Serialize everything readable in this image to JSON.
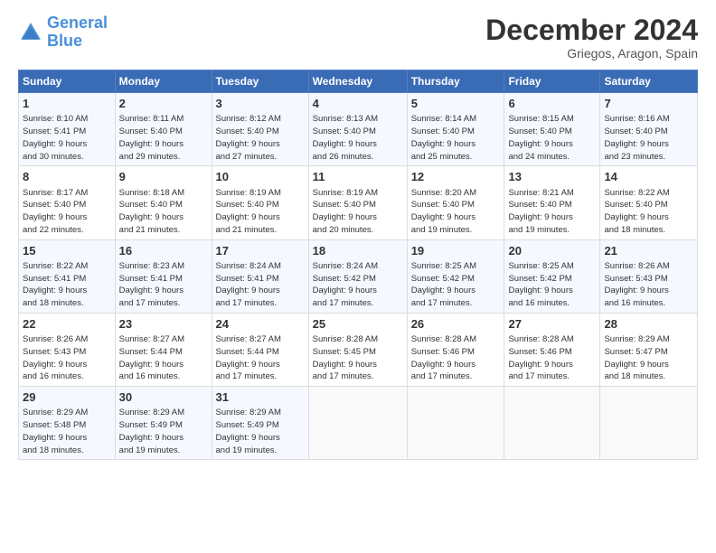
{
  "header": {
    "logo_line1": "General",
    "logo_line2": "Blue",
    "month_title": "December 2024",
    "subtitle": "Griegos, Aragon, Spain"
  },
  "weekdays": [
    "Sunday",
    "Monday",
    "Tuesday",
    "Wednesday",
    "Thursday",
    "Friday",
    "Saturday"
  ],
  "weeks": [
    [
      {
        "day": "1",
        "info": "Sunrise: 8:10 AM\nSunset: 5:41 PM\nDaylight: 9 hours\nand 30 minutes."
      },
      {
        "day": "2",
        "info": "Sunrise: 8:11 AM\nSunset: 5:40 PM\nDaylight: 9 hours\nand 29 minutes."
      },
      {
        "day": "3",
        "info": "Sunrise: 8:12 AM\nSunset: 5:40 PM\nDaylight: 9 hours\nand 27 minutes."
      },
      {
        "day": "4",
        "info": "Sunrise: 8:13 AM\nSunset: 5:40 PM\nDaylight: 9 hours\nand 26 minutes."
      },
      {
        "day": "5",
        "info": "Sunrise: 8:14 AM\nSunset: 5:40 PM\nDaylight: 9 hours\nand 25 minutes."
      },
      {
        "day": "6",
        "info": "Sunrise: 8:15 AM\nSunset: 5:40 PM\nDaylight: 9 hours\nand 24 minutes."
      },
      {
        "day": "7",
        "info": "Sunrise: 8:16 AM\nSunset: 5:40 PM\nDaylight: 9 hours\nand 23 minutes."
      }
    ],
    [
      {
        "day": "8",
        "info": "Sunrise: 8:17 AM\nSunset: 5:40 PM\nDaylight: 9 hours\nand 22 minutes."
      },
      {
        "day": "9",
        "info": "Sunrise: 8:18 AM\nSunset: 5:40 PM\nDaylight: 9 hours\nand 21 minutes."
      },
      {
        "day": "10",
        "info": "Sunrise: 8:19 AM\nSunset: 5:40 PM\nDaylight: 9 hours\nand 21 minutes."
      },
      {
        "day": "11",
        "info": "Sunrise: 8:19 AM\nSunset: 5:40 PM\nDaylight: 9 hours\nand 20 minutes."
      },
      {
        "day": "12",
        "info": "Sunrise: 8:20 AM\nSunset: 5:40 PM\nDaylight: 9 hours\nand 19 minutes."
      },
      {
        "day": "13",
        "info": "Sunrise: 8:21 AM\nSunset: 5:40 PM\nDaylight: 9 hours\nand 19 minutes."
      },
      {
        "day": "14",
        "info": "Sunrise: 8:22 AM\nSunset: 5:40 PM\nDaylight: 9 hours\nand 18 minutes."
      }
    ],
    [
      {
        "day": "15",
        "info": "Sunrise: 8:22 AM\nSunset: 5:41 PM\nDaylight: 9 hours\nand 18 minutes."
      },
      {
        "day": "16",
        "info": "Sunrise: 8:23 AM\nSunset: 5:41 PM\nDaylight: 9 hours\nand 17 minutes."
      },
      {
        "day": "17",
        "info": "Sunrise: 8:24 AM\nSunset: 5:41 PM\nDaylight: 9 hours\nand 17 minutes."
      },
      {
        "day": "18",
        "info": "Sunrise: 8:24 AM\nSunset: 5:42 PM\nDaylight: 9 hours\nand 17 minutes."
      },
      {
        "day": "19",
        "info": "Sunrise: 8:25 AM\nSunset: 5:42 PM\nDaylight: 9 hours\nand 17 minutes."
      },
      {
        "day": "20",
        "info": "Sunrise: 8:25 AM\nSunset: 5:42 PM\nDaylight: 9 hours\nand 16 minutes."
      },
      {
        "day": "21",
        "info": "Sunrise: 8:26 AM\nSunset: 5:43 PM\nDaylight: 9 hours\nand 16 minutes."
      }
    ],
    [
      {
        "day": "22",
        "info": "Sunrise: 8:26 AM\nSunset: 5:43 PM\nDaylight: 9 hours\nand 16 minutes."
      },
      {
        "day": "23",
        "info": "Sunrise: 8:27 AM\nSunset: 5:44 PM\nDaylight: 9 hours\nand 16 minutes."
      },
      {
        "day": "24",
        "info": "Sunrise: 8:27 AM\nSunset: 5:44 PM\nDaylight: 9 hours\nand 17 minutes."
      },
      {
        "day": "25",
        "info": "Sunrise: 8:28 AM\nSunset: 5:45 PM\nDaylight: 9 hours\nand 17 minutes."
      },
      {
        "day": "26",
        "info": "Sunrise: 8:28 AM\nSunset: 5:46 PM\nDaylight: 9 hours\nand 17 minutes."
      },
      {
        "day": "27",
        "info": "Sunrise: 8:28 AM\nSunset: 5:46 PM\nDaylight: 9 hours\nand 17 minutes."
      },
      {
        "day": "28",
        "info": "Sunrise: 8:29 AM\nSunset: 5:47 PM\nDaylight: 9 hours\nand 18 minutes."
      }
    ],
    [
      {
        "day": "29",
        "info": "Sunrise: 8:29 AM\nSunset: 5:48 PM\nDaylight: 9 hours\nand 18 minutes."
      },
      {
        "day": "30",
        "info": "Sunrise: 8:29 AM\nSunset: 5:49 PM\nDaylight: 9 hours\nand 19 minutes."
      },
      {
        "day": "31",
        "info": "Sunrise: 8:29 AM\nSunset: 5:49 PM\nDaylight: 9 hours\nand 19 minutes."
      },
      null,
      null,
      null,
      null
    ]
  ]
}
